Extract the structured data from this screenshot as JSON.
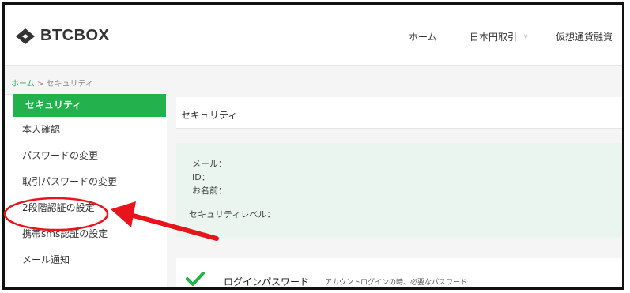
{
  "header": {
    "logo_text": "BTCBOX",
    "nav": [
      "ホーム",
      "日本円取引",
      "仮想通貨融資"
    ],
    "caret": "∨"
  },
  "breadcrumb": {
    "home": "ホーム",
    "separator": " > ",
    "current": "セキュリティ"
  },
  "sidebar": {
    "active": "セキュリティ",
    "items": [
      {
        "label": "本人確認"
      },
      {
        "label": "パスワードの変更"
      },
      {
        "label": "取引パスワードの変更"
      },
      {
        "label": "2段階認証の設定"
      },
      {
        "label": "携帯sms認証の設定"
      },
      {
        "label": "メール通知"
      }
    ]
  },
  "main": {
    "title": "セキュリティ",
    "info": {
      "mail": "メール：",
      "id": "ID：",
      "name": "お名前：",
      "level": "セキュリティレベル："
    },
    "row": {
      "title": "ログインパスワード",
      "desc": "アカウントログインの時、必要なパスワード"
    }
  },
  "colors": {
    "accent": "#22b14c",
    "annotation": "#e8141b"
  }
}
